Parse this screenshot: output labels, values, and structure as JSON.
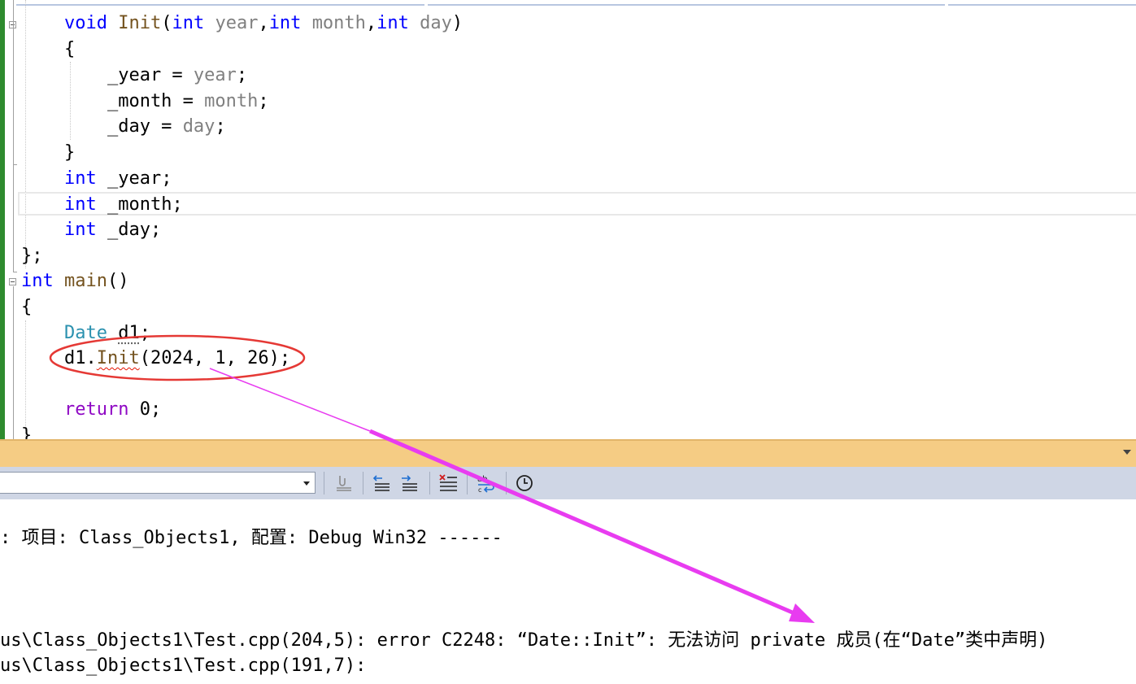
{
  "editor": {
    "lines": [
      {
        "parts": [
          {
            "t": "    "
          },
          {
            "t": "void",
            "c": "kw"
          },
          {
            "t": " "
          },
          {
            "t": "Init",
            "c": "fn"
          },
          {
            "t": "("
          },
          {
            "t": "int",
            "c": "kw"
          },
          {
            "t": " "
          },
          {
            "t": "year",
            "c": "param"
          },
          {
            "t": ","
          },
          {
            "t": "int",
            "c": "kw"
          },
          {
            "t": " "
          },
          {
            "t": "month",
            "c": "param"
          },
          {
            "t": ","
          },
          {
            "t": "int",
            "c": "kw"
          },
          {
            "t": " "
          },
          {
            "t": "day",
            "c": "param"
          },
          {
            "t": ")"
          }
        ]
      },
      {
        "parts": [
          {
            "t": "    {"
          }
        ]
      },
      {
        "parts": [
          {
            "t": "        _year = "
          },
          {
            "t": "year",
            "c": "param"
          },
          {
            "t": ";"
          }
        ]
      },
      {
        "parts": [
          {
            "t": "        _month = "
          },
          {
            "t": "month",
            "c": "param"
          },
          {
            "t": ";"
          }
        ]
      },
      {
        "parts": [
          {
            "t": "        _day = "
          },
          {
            "t": "day",
            "c": "param"
          },
          {
            "t": ";"
          }
        ]
      },
      {
        "parts": [
          {
            "t": "    }"
          }
        ]
      },
      {
        "parts": [
          {
            "t": "    "
          },
          {
            "t": "int",
            "c": "kw"
          },
          {
            "t": " _year;"
          }
        ]
      },
      {
        "parts": [
          {
            "t": "    "
          },
          {
            "t": "int",
            "c": "kw"
          },
          {
            "t": " _month;"
          }
        ]
      },
      {
        "parts": [
          {
            "t": "    "
          },
          {
            "t": "int",
            "c": "kw"
          },
          {
            "t": " _day;"
          }
        ]
      },
      {
        "parts": [
          {
            "t": "};"
          }
        ]
      },
      {
        "parts": [
          {
            "t": "int",
            "c": "kw"
          },
          {
            "t": " "
          },
          {
            "t": "main",
            "c": "fn"
          },
          {
            "t": "()"
          }
        ]
      },
      {
        "parts": [
          {
            "t": "{"
          }
        ]
      },
      {
        "parts": [
          {
            "t": "    "
          },
          {
            "t": "Date",
            "c": "type"
          },
          {
            "t": " "
          },
          {
            "t": "d1",
            "c": "dotted"
          },
          {
            "t": ";"
          }
        ]
      },
      {
        "parts": [
          {
            "t": "    d1."
          },
          {
            "t": "Init",
            "c": "fn squiggle"
          },
          {
            "t": "(2024, 1, 26);"
          }
        ]
      },
      {
        "parts": [
          {
            "t": ""
          }
        ]
      },
      {
        "parts": [
          {
            "t": "    "
          },
          {
            "t": "return",
            "c": "ctl"
          },
          {
            "t": " 0;"
          }
        ]
      },
      {
        "parts": [
          {
            "t": "}"
          }
        ]
      }
    ]
  },
  "output": {
    "lines": [
      ": 项目: Class_Objects1, 配置: Debug Win32 ------",
      "",
      "",
      "",
      "us\\Class_Objects1\\Test.cpp(204,5): error C2248: “Date::Init”: 无法访问 private 成员(在“Date”类中声明)",
      "us\\Class_Objects1\\Test.cpp(191,7):"
    ]
  },
  "toolbar": {
    "source_value": "",
    "buttons": [
      "find-message-icon",
      "previous-message-icon",
      "next-message-icon",
      "clear-all-icon",
      "toggle-word-wrap-icon",
      "timestamp-icon"
    ]
  },
  "annotation": {
    "circle_color": "#e53935",
    "arrow_color": "#e83cf0"
  }
}
